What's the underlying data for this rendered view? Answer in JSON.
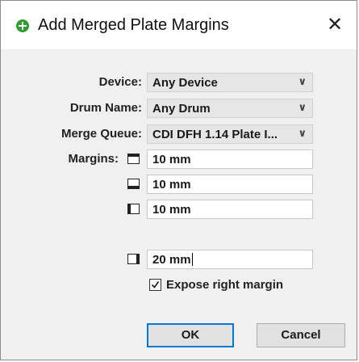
{
  "dialog": {
    "title": "Add Merged Plate Margins",
    "close_glyph": "✕"
  },
  "fields": {
    "device_label": "Device:",
    "device_value": "Any Device",
    "drum_label": "Drum Name:",
    "drum_value": "Any Drum",
    "queue_label": "Merge Queue:",
    "queue_value": "CDI DFH 1.14 Plate I...",
    "margins_label": "Margins:"
  },
  "margins": {
    "top_value": "10 mm",
    "bottom_value": "10 mm",
    "left_value": "10 mm",
    "right_value": "20 mm"
  },
  "options": {
    "expose_right_label": "Expose right margin",
    "expose_right_checked": true
  },
  "buttons": {
    "ok_label": "OK",
    "cancel_label": "Cancel"
  },
  "icons": {
    "title": "add-circle-icon",
    "dropdown": "chevron-down-icon",
    "margin_sides": [
      "margin-top-icon",
      "margin-bottom-icon",
      "margin-left-icon",
      "margin-right-icon"
    ]
  },
  "colors": {
    "accent": "#0078d7",
    "title_icon": "#2f9e2f"
  }
}
